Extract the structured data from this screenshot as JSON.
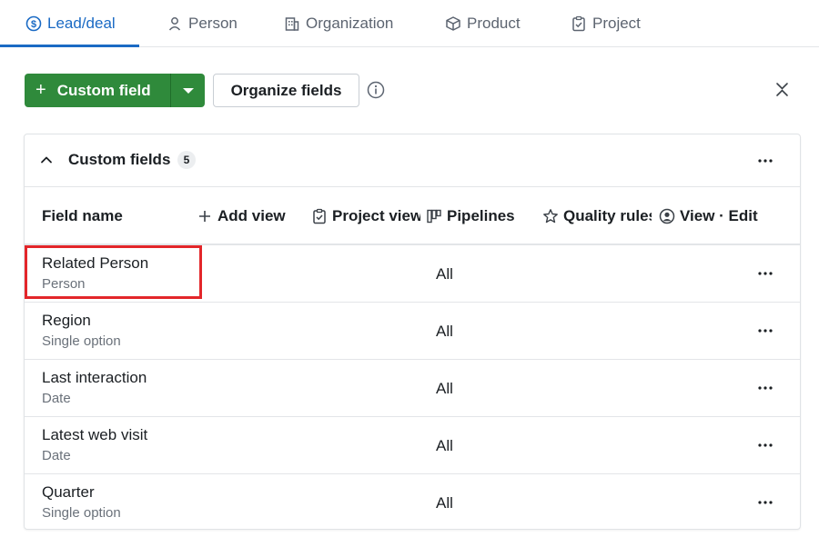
{
  "tabs": [
    {
      "label": "Lead/deal",
      "icon": "dollar-circle-icon",
      "active": true
    },
    {
      "label": "Person",
      "icon": "person-icon"
    },
    {
      "label": "Organization",
      "icon": "building-icon"
    },
    {
      "label": "Product",
      "icon": "box-icon"
    },
    {
      "label": "Project",
      "icon": "clipboard-check-icon"
    }
  ],
  "toolbar": {
    "custom_field_label": "Custom field",
    "organize_fields_label": "Organize fields"
  },
  "card": {
    "title": "Custom fields",
    "count": "5",
    "columns": [
      {
        "label": "Field name"
      },
      {
        "label": "Add view",
        "icon": "plus-icon"
      },
      {
        "label": "Project view",
        "icon": "clipboard-check-icon"
      },
      {
        "label": "Pipelines",
        "icon": "pipelines-icon"
      },
      {
        "label": "Quality rules",
        "icon": "star-icon"
      },
      {
        "label": "View · Edit",
        "icon": "user-circle-icon"
      }
    ],
    "rows": [
      {
        "name": "Related Person",
        "type": "Person",
        "value": "All"
      },
      {
        "name": "Region",
        "type": "Single option",
        "value": "All"
      },
      {
        "name": "Last interaction",
        "type": "Date",
        "value": "All"
      },
      {
        "name": "Latest web visit",
        "type": "Date",
        "value": "All"
      },
      {
        "name": "Quarter",
        "type": "Single option",
        "value": "All"
      }
    ]
  },
  "colors": {
    "accent": "#1a6ac4",
    "primary_button": "#2f8a3b",
    "highlight": "#e3262a"
  }
}
